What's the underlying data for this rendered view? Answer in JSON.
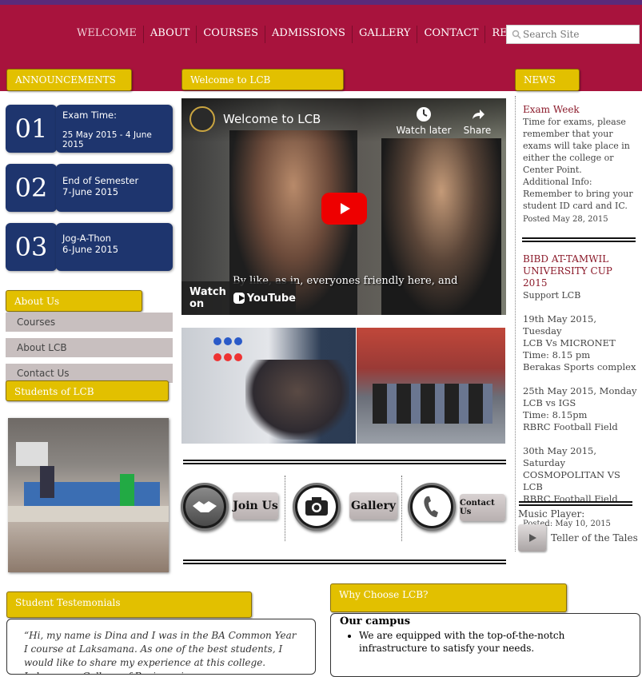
{
  "nav": {
    "items": [
      "WELCOME",
      "ABOUT",
      "COURSES",
      "ADMISSIONS",
      "GALLERY",
      "CONTACT",
      "REFERENCES"
    ],
    "search_placeholder": "Search Site"
  },
  "announcements": {
    "title": "ANNOUNCEMENTS",
    "items": [
      {
        "number": "01",
        "line1": "Exam Time:",
        "line2": "25 May 2015 - 4 June 2015"
      },
      {
        "number": "02",
        "line1": "End of Semester",
        "line2": "7-June 2015"
      },
      {
        "number": "03",
        "line1": "Jog-A-Thon",
        "line2": "6-June 2015"
      }
    ]
  },
  "about": {
    "title": "About Us",
    "links": [
      "Courses",
      "About LCB",
      "Contact Us"
    ]
  },
  "students": {
    "title": "Students of LCB"
  },
  "welcome": {
    "title": "Welcome to LCB",
    "video_title": "Welcome to LCB",
    "watch_later": "Watch later",
    "share": "Share",
    "subtitle": "By like, as in, everyones friendly here, and",
    "watch_on": "Watch on",
    "youtube": "YouTube"
  },
  "actions": {
    "join": "Join Us",
    "gallery": "Gallery",
    "contact": "Contact Us"
  },
  "news": {
    "title": "NEWS",
    "item1": {
      "head": "Exam Week",
      "body": "Time for exams, please remember that your exams will take place in either the college or Center Point.",
      "extra": "Additional Info: Remember to bring your student ID card and IC.",
      "posted": "Posted May 28, 2015"
    },
    "item2": {
      "head": "BIBD AT-TAMWIL UNIVERSITY CUP 2015",
      "sub": "Support LCB",
      "match1": [
        "19th May 2015, Tuesday",
        "LCB Vs MICRONET",
        "Time: 8.15 pm",
        "Berakas Sports complex"
      ],
      "match2": [
        "25th May 2015, Monday",
        "LCB vs IGS",
        "Time: 8.15pm",
        "RBRC Football Field"
      ],
      "match3": [
        "30th May 2015, Saturday",
        "COSMOPOLITAN VS LCB",
        "RBRC Football Field"
      ],
      "posted": "Posted: May 10, 2015"
    }
  },
  "music": {
    "label": "Music Player:",
    "track": "Teller of the Tales"
  },
  "testimonials": {
    "title": "Student Testemonials",
    "text": "“Hi, my name is Dina and I was in the BA Common Year I course at Laksamana. As one of the best students, I would like to share my experience at this college. Laksamana College of Business is a"
  },
  "why": {
    "title": "Why Choose LCB?",
    "heading": "Our campus",
    "bullet1": "We are equipped with the top-of-the-notch infrastructure to satisfy your needs."
  },
  "colors": {
    "header": "#a8133d",
    "gold": "#e2c000",
    "navy": "#1e356e"
  }
}
